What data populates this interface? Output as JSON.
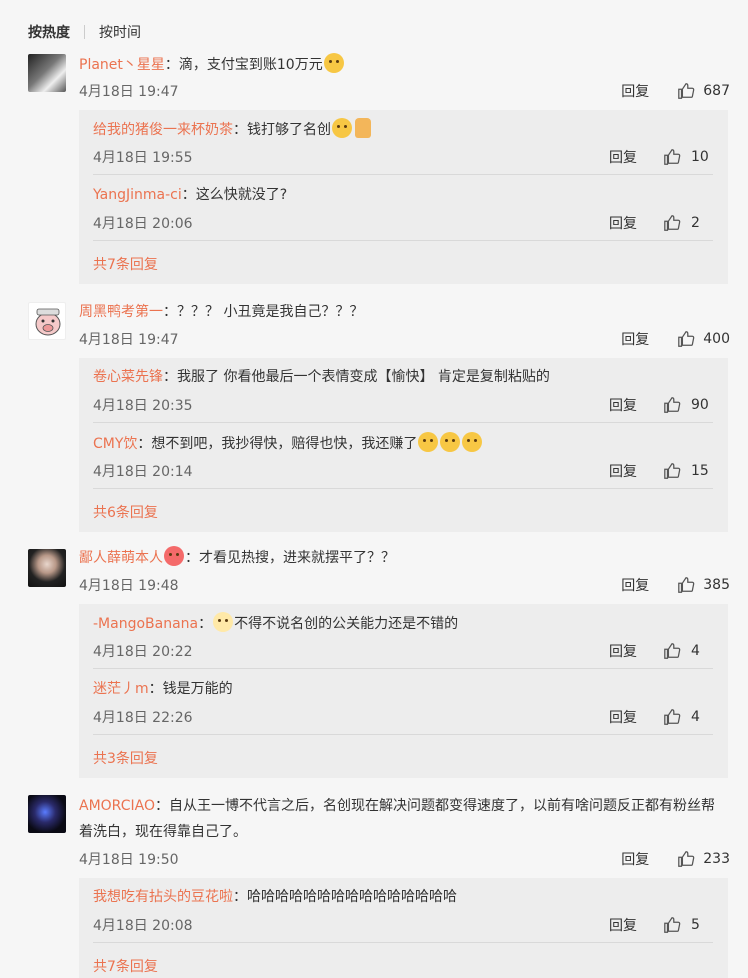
{
  "sort": {
    "hot": "按热度",
    "time": "按时间"
  },
  "reply_label": "回复",
  "comments": [
    {
      "user": "Planet丶星星",
      "sep": "：",
      "text": "滴，支付宝到账10万元",
      "emoji": "laugh-emoji",
      "time": "4月18日 19:47",
      "likes": "687",
      "replies": [
        {
          "user": "给我的猪俊一来杯奶茶",
          "sep": "：",
          "text": "钱打够了名创",
          "emoji": "doge-emoji",
          "time": "4月18日 19:55",
          "likes": "10"
        },
        {
          "user": "YangJinma-ci",
          "sep": "：",
          "text": "这么快就没了?",
          "emoji": "",
          "time": "4月18日 20:06",
          "likes": "2"
        }
      ],
      "more": "共7条回复"
    },
    {
      "user": "周黑鸭考第一",
      "sep": "：",
      "text": "？？？ 小丑竟是我自己？？？",
      "emoji": "",
      "time": "4月18日 19:47",
      "likes": "400",
      "replies": [
        {
          "user": "卷心菜先锋",
          "sep": "：",
          "text": "我服了 你看他最后一个表情变成【愉快】 肯定是复制粘贴的",
          "emoji": "",
          "time": "4月18日 20:35",
          "likes": "90"
        },
        {
          "user": "CMY饮",
          "sep": "：",
          "text": "想不到吧，我抄得快，赔得也快，我还赚了",
          "emoji": "doge-emoji",
          "time": "4月18日 20:14",
          "likes": "15"
        }
      ],
      "more": "共6条回复"
    },
    {
      "user": "鄙人薛萌本人",
      "sep": "：",
      "text": "才看见热搜，进来就摆平了？？",
      "emoji": "",
      "time": "4月18日 19:48",
      "likes": "385",
      "replies": [
        {
          "user": "-MangoBanana",
          "sep": "：",
          "text": "不得不说名创的公关能力还是不错的",
          "emoji": "glasses-emoji",
          "time": "4月18日 20:22",
          "likes": "4"
        },
        {
          "user": "迷茫丿m",
          "sep": "：",
          "text": "钱是万能的",
          "emoji": "",
          "time": "4月18日 22:26",
          "likes": "4"
        }
      ],
      "more": "共3条回复"
    },
    {
      "user": "AMORCIAO",
      "sep": "：",
      "text": "自从王一博不代言之后，名创现在解决问题都变得速度了，以前有啥问题反正都有粉丝帮着洗白，现在得靠自己了。",
      "emoji": "",
      "time": "4月18日 19:50",
      "likes": "233",
      "replies": [
        {
          "user": "我想吃有拈头的豆花啦",
          "sep": "：",
          "text": "哈哈哈哈哈哈哈哈哈哈哈哈哈哈哈",
          "emoji": "",
          "time": "4月18日 20:08",
          "likes": "5"
        }
      ],
      "more": "共7条回复"
    }
  ]
}
